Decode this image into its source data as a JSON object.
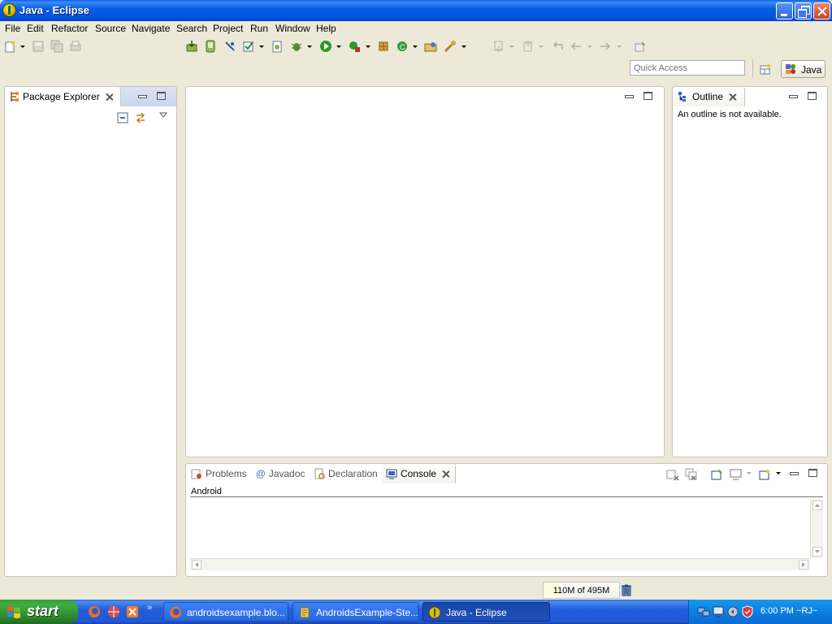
{
  "window": {
    "title": "Java - Eclipse"
  },
  "menu": [
    "File",
    "Edit",
    "Refactor",
    "Source",
    "Navigate",
    "Search",
    "Project",
    "Run",
    "Window",
    "Help"
  ],
  "toolbar": {
    "quick_access_placeholder": "Quick Access",
    "perspective_label": "Java"
  },
  "package_explorer": {
    "tab_label": "Package Explorer"
  },
  "outline": {
    "tab_label": "Outline",
    "message": "An outline is not available."
  },
  "bottom_panel": {
    "tabs": [
      "Problems",
      "Javadoc",
      "Declaration",
      "Console"
    ],
    "console_name": "Android"
  },
  "status": {
    "heap": "110M of 495M",
    "heap_used_fraction": 0.22
  },
  "taskbar": {
    "start_label": "start",
    "tasks": [
      "androidsexample.blo...",
      "AndroidsExample-Ste...",
      "Java - Eclipse"
    ],
    "clock": "6:00 PM ~RJ~"
  },
  "colors": {
    "titlebar": "#0053dd",
    "taskbar": "#245edb",
    "start": "#3fae3f",
    "chrome": "#ece9d8"
  }
}
